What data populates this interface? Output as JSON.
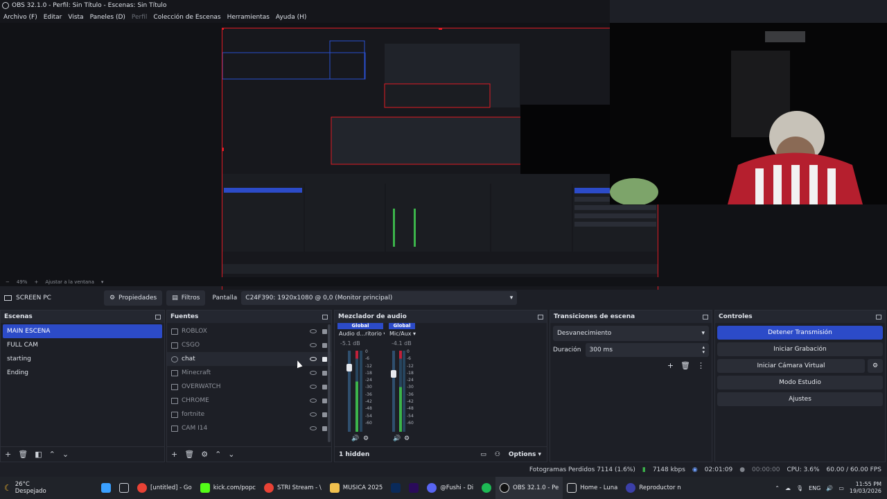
{
  "window": {
    "title": "OBS 32.1.0 - Perfil: Sin Título - Escenas: Sin Título"
  },
  "menu": [
    "Archivo (F)",
    "Editar",
    "Vista",
    "Paneles (D)",
    "Perfil",
    "Colección de Escenas",
    "Herramientas",
    "Ayuda (H)"
  ],
  "zoom": {
    "percent": "49%",
    "fit_label": "Ajustar a la ventana"
  },
  "source_toolbar": {
    "source_name": "SCREEN PC",
    "properties_label": "Propiedades",
    "filters_label": "Filtros",
    "display_label": "Pantalla",
    "display_value": "C24F390: 1920x1080 @ 0,0 (Monitor principal)"
  },
  "scenes": {
    "title": "Escenas",
    "items": [
      "MAIN ESCENA",
      "FULL CAM",
      "starting",
      "Ending"
    ]
  },
  "sources": {
    "title": "Fuentes",
    "items": [
      "ROBLOX",
      "CSGO",
      "chat",
      "Minecraft",
      "OVERWATCH",
      "CHROME",
      "fortnite",
      "CAM I14"
    ]
  },
  "mixer": {
    "title": "Mezclador de audio",
    "channels": [
      {
        "header": "Global",
        "name": "Audio d...ritorio",
        "db": "-5.1 dB",
        "level": 0.62
      },
      {
        "header": "Global",
        "name": "Mic/Aux",
        "db": "-4.1 dB",
        "level": 0.55
      }
    ],
    "scale": [
      "0",
      "-6",
      "-12",
      "-18",
      "-24",
      "-30",
      "-36",
      "-42",
      "-48",
      "-54",
      "-60"
    ],
    "hidden_label": "1 hidden",
    "options_label": "Options"
  },
  "transitions": {
    "title": "Transiciones de escena",
    "selected": "Desvanecimiento",
    "duration_label": "Duración",
    "duration_value": "300 ms"
  },
  "controls": {
    "title": "Controles",
    "stop_stream": "Detener Transmisión",
    "start_record": "Iniciar Grabación",
    "virtual_cam": "Iniciar Cámara Virtual",
    "studio_mode": "Modo Estudio",
    "settings": "Ajustes"
  },
  "status": {
    "dropped": "Fotogramas Perdidos 7114 (1.6%)",
    "bitrate": "7148 kbps",
    "stream_time": "02:01:09",
    "record_time": "00:00:00",
    "cpu": "CPU: 3.6%",
    "fps": "60.00 / 60.00 FPS"
  },
  "taskbar": {
    "weather_temp": "26°C",
    "weather_desc": "Despejado",
    "apps": [
      "[untitled] - Go",
      "kick.com/popc",
      "STRI Stream - \\",
      "MUSICA 2025",
      "@Fushi - Di",
      "OBS 32.1.0 - Pe",
      "Home - Luna",
      "Reproductor n"
    ],
    "lang": "ENG",
    "time": "11:55 PM",
    "date": "19/03/2026"
  },
  "colors": {
    "accent": "#2c4bc8",
    "selection_red": "#e01b24",
    "meter_green": "#3cb44b",
    "meter_red": "#c0213a"
  }
}
